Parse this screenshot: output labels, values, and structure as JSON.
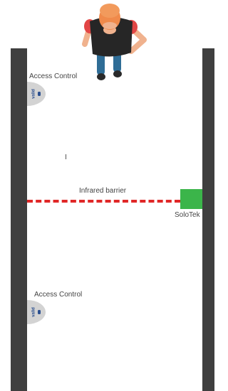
{
  "diagram": {
    "readers": [
      {
        "label": "Access Control",
        "badge_text": "valid"
      },
      {
        "label": "Access Control",
        "badge_text": "valid"
      }
    ],
    "barrier_label": "Infrared barrier",
    "sensor_label": "SoloTek"
  },
  "colors": {
    "wall": "#3f3f3f",
    "barrier": "#e02727",
    "sensor": "#3bb54a",
    "reader": "#d3d3d3",
    "badge": "#2b4f8f"
  },
  "icons": [
    "person-icon",
    "reader-icon"
  ]
}
